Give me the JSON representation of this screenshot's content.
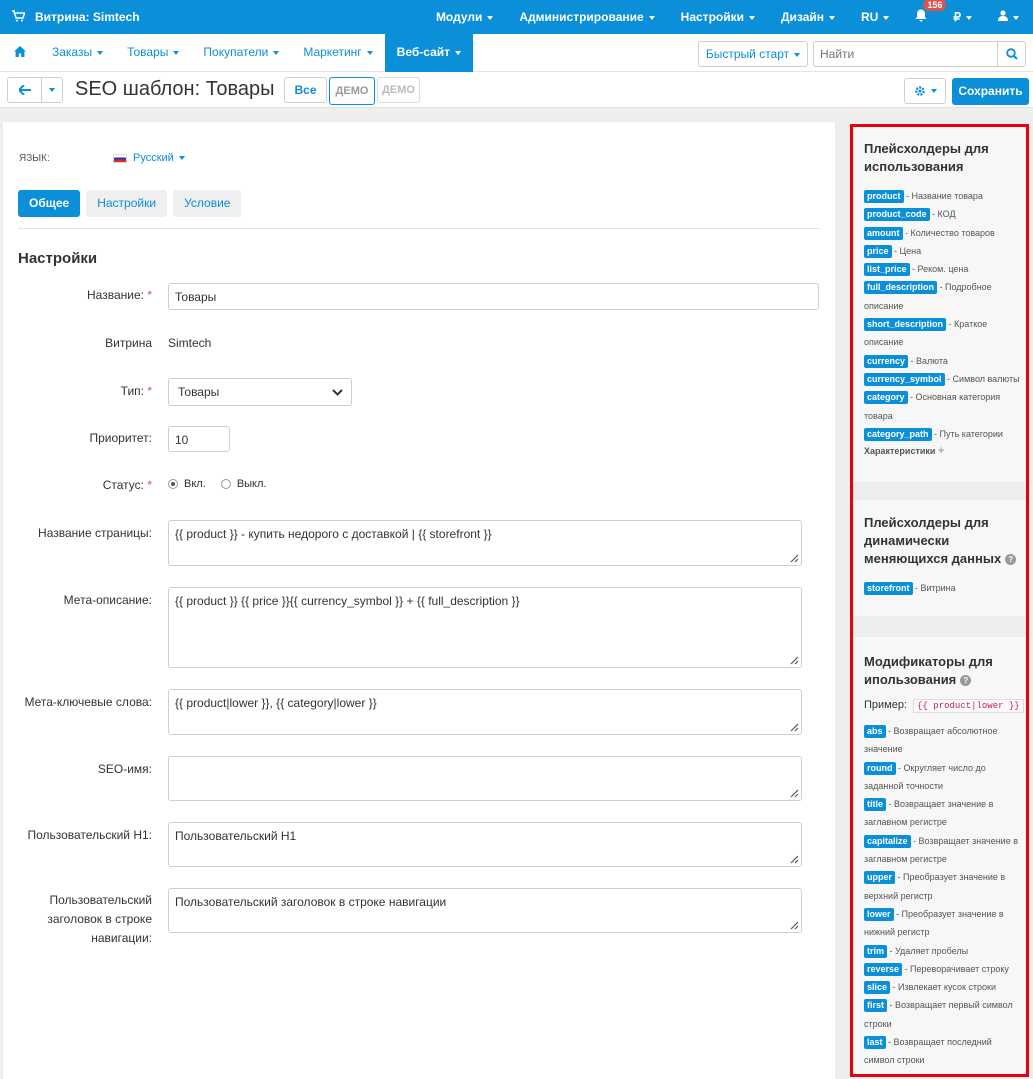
{
  "topbar": {
    "store_name": "Витрина: Simtech",
    "menu": [
      "Модули",
      "Администрирование",
      "Настройки",
      "Дизайн",
      "RU"
    ],
    "notifications": "156",
    "currency": "₽"
  },
  "subnav": {
    "items": [
      "Заказы",
      "Товары",
      "Покупатели",
      "Маркетинг",
      "Веб-сайт"
    ],
    "quick_start": "Быстрый старт",
    "search_placeholder": "Найти"
  },
  "titlebar": {
    "title": "SEO шаблон: Товары",
    "all_btn": "Все",
    "demo1": "ДЕМО",
    "demo2": "ДЕМО",
    "save": "Сохранить"
  },
  "form": {
    "lang_label": "ЯЗЫК:",
    "lang_value": "Русский",
    "tabs": [
      "Общее",
      "Настройки",
      "Условие"
    ],
    "section_title": "Настройки",
    "name_label": "Название:",
    "name_value": "Товары",
    "storefront_label": "Витрина",
    "storefront_value": "Simtech",
    "type_label": "Тип:",
    "type_value": "Товары",
    "priority_label": "Приоритет:",
    "priority_value": "10",
    "status_label": "Статус:",
    "status_on": "Вкл.",
    "status_off": "Выкл.",
    "page_title_label": "Название страницы:",
    "page_title_value": "{{ product }} - купить недорого с доставкой | {{ storefront }}",
    "meta_desc_label": "Мета-описание:",
    "meta_desc_value": "{{ product }} {{ price }}{{ currency_symbol }} + {{ full_description }}",
    "meta_kw_label": "Мета-ключевые слова:",
    "meta_kw_value": "{{ product|lower }}, {{ category|lower }}",
    "seo_name_label": "SEO-имя:",
    "seo_name_value": "",
    "h1_label": "Пользовательский H1:",
    "h1_value": "Пользовательский H1",
    "breadcrumb_label_1": "Пользовательский",
    "breadcrumb_label_2": "заголовок в строке",
    "breadcrumb_label_3": "навигации:",
    "breadcrumb_value": "Пользовательский заголовок в строке навигации"
  },
  "sidebar": {
    "placeholders_title_1": "Плейсхолдеры для",
    "placeholders_title_2": "использования",
    "placeholders": [
      {
        "tag": "product",
        "desc": " - Название товара"
      },
      {
        "tag": "product_code",
        "desc": " - КОД"
      },
      {
        "tag": "amount",
        "desc": " - Количество товаров"
      },
      {
        "tag": "price",
        "desc": " - Цена"
      },
      {
        "tag": "list_price",
        "desc": " - Реком. цена"
      },
      {
        "tag": "full_description",
        "desc": " - Подробное описание"
      },
      {
        "tag": "short_description",
        "desc": " - Краткое описание"
      },
      {
        "tag": "currency",
        "desc": " - Валюта"
      },
      {
        "tag": "currency_symbol",
        "desc": " - Символ валюты"
      },
      {
        "tag": "category",
        "desc": " - Основная категория товара"
      },
      {
        "tag": "category_path",
        "desc": " - Путь категории"
      }
    ],
    "characteristics": "Характеристики",
    "dynamic_title_1": "Плейсхолдеры для",
    "dynamic_title_2": "динамически",
    "dynamic_title_3": "меняющихся данных",
    "dynamic": [
      {
        "tag": "storefront",
        "desc": " - Витрина"
      }
    ],
    "modifiers_title_1": "Модификаторы для",
    "modifiers_title_2": "ипользования",
    "example_label": "Пример:",
    "example_code": "{{ product|lower }}",
    "modifiers": [
      {
        "tag": "abs",
        "desc": " - Возвращает абсолютное значение"
      },
      {
        "tag": "round",
        "desc": " - Округляет число до заданной точности"
      },
      {
        "tag": "title",
        "desc": " - Возвращает значение в заглавном регистре"
      },
      {
        "tag": "capitalize",
        "desc": " - Возвращает значение в заглавном регистре"
      },
      {
        "tag": "upper",
        "desc": " - Преобразует значение в верхний регистр"
      },
      {
        "tag": "lower",
        "desc": " - Преобразует значение в нижний регистр"
      },
      {
        "tag": "trim",
        "desc": " - Удаляет пробелы"
      },
      {
        "tag": "reverse",
        "desc": " - Переворачивает строку"
      },
      {
        "tag": "slice",
        "desc": " - Извлекает кусок строки"
      },
      {
        "tag": "first",
        "desc": " - Возвращает первый символ строки"
      },
      {
        "tag": "last",
        "desc": " - Возвращает последний символ строки"
      }
    ]
  }
}
